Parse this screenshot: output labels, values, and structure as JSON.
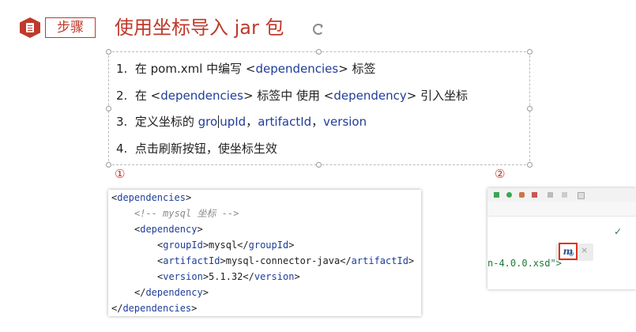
{
  "header": {
    "step_label": "步骤",
    "title": "使用坐标导入 jar 包"
  },
  "steps": [
    {
      "num": "1.",
      "pre": "在 pom.xml 中编写 <",
      "kw": "dependencies",
      "post": "> 标签"
    },
    {
      "num": "2.",
      "pre": "在 <",
      "kw": "dependencies",
      "mid": "> 标签中 使用 <",
      "kw2": "dependency",
      "post": "> 引入坐标"
    },
    {
      "num": "3.",
      "pre": "定义坐标的 ",
      "kw_a": "gro",
      "kw_b": "upId",
      "sep1": "，",
      "kw2": "artifactId",
      "sep2": "，",
      "kw3": "version"
    },
    {
      "num": "4.",
      "text": "点击刷新按钮，使坐标生效"
    }
  ],
  "markers": {
    "one": "①",
    "two": "②"
  },
  "code": {
    "l1_open": "<",
    "l1_tag": "dependencies",
    "l1_close": ">",
    "l2_comment": "<!-- mysql 坐标 -->",
    "l3_open": "<",
    "l3_tag": "dependency",
    "l3_close": ">",
    "l4_a": "<",
    "l4_tag": "groupId",
    "l4_b": ">",
    "l4_val": "mysql",
    "l4_c": "</",
    "l4_tag2": "groupId",
    "l4_d": ">",
    "l5_a": "<",
    "l5_tag": "artifactId",
    "l5_b": ">",
    "l5_val": "mysql-connector-java",
    "l5_c": "</",
    "l5_tag2": "artifactId",
    "l5_d": ">",
    "l6_a": "<",
    "l6_tag": "version",
    "l6_b": ">",
    "l6_val": "5.1.32",
    "l6_c": "</",
    "l6_tag2": "version",
    "l6_d": ">",
    "l7_open": "</",
    "l7_tag": "dependency",
    "l7_close": ">",
    "l8_open": "</",
    "l8_tag": "dependencies",
    "l8_close": ">"
  },
  "ide": {
    "xsd_text": "n-4.0.0.xsd\">",
    "maven_icon_label": "m",
    "close_glyph": "×",
    "chevron_glyph": "✓"
  },
  "colors": {
    "accent": "#c0392b",
    "tag": "#1f3d99",
    "highlight": "#e0301e"
  }
}
